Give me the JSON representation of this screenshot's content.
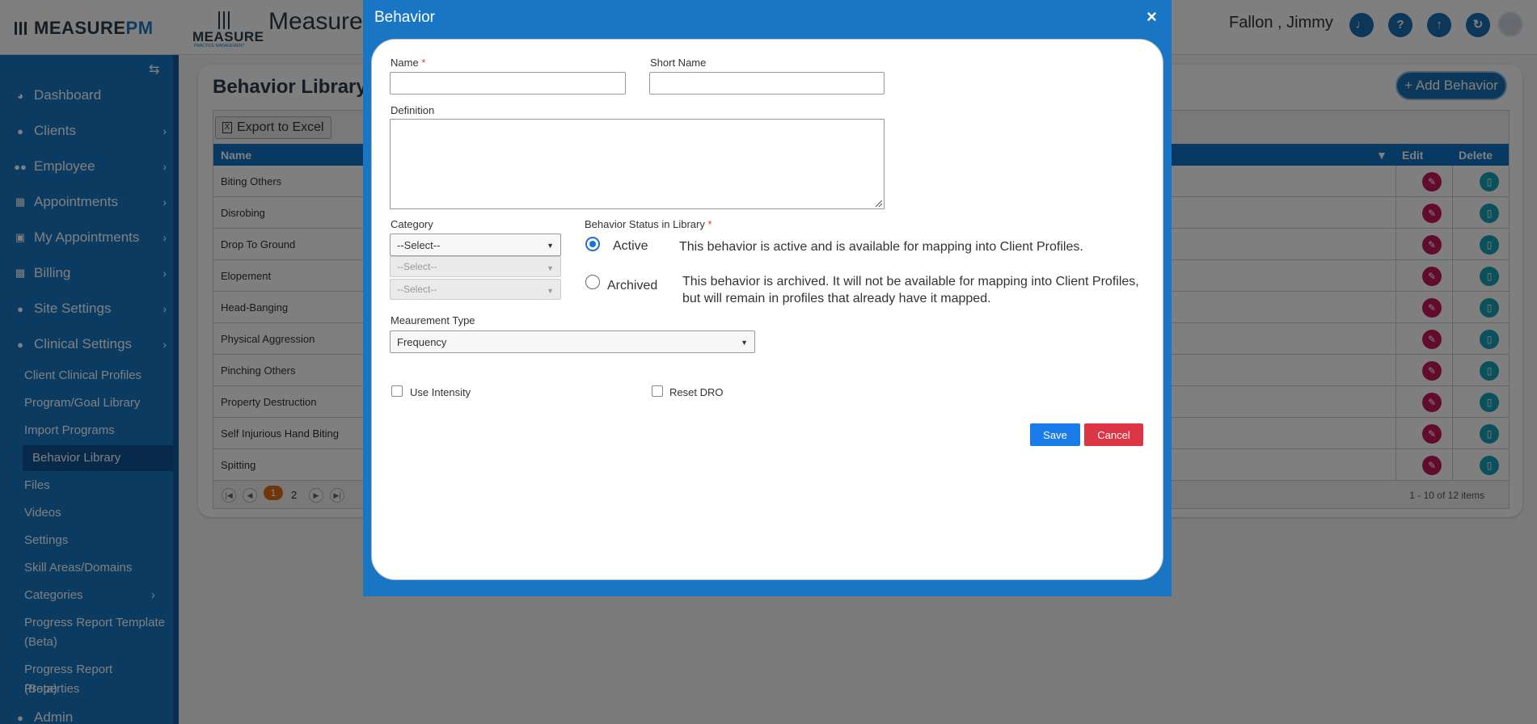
{
  "header": {
    "brand_main": "MEASURE",
    "brand_accent": "PM",
    "practice_logo_word": "MEASURE",
    "practice_logo_sub": "PRACTICE MANAGEMENT",
    "app_title": "MeasureP",
    "user_name": "Fallon , Jimmy",
    "icons": [
      "bell-icon",
      "help-icon",
      "upload-icon",
      "refresh-icon",
      "avatar"
    ]
  },
  "sidebar": {
    "items": [
      {
        "label": "Dashboard",
        "icon": "dashboard-icon"
      },
      {
        "label": "Clients",
        "icon": "user-icon"
      },
      {
        "label": "Employee",
        "icon": "users-icon"
      },
      {
        "label": "Appointments",
        "icon": "calendar-icon"
      },
      {
        "label": "My Appointments",
        "icon": "book-icon"
      },
      {
        "label": "Billing",
        "icon": "money-icon"
      },
      {
        "label": "Site Settings",
        "icon": "user-icon"
      },
      {
        "label": "Clinical Settings",
        "icon": "user-icon"
      }
    ],
    "sub_items": [
      {
        "label": "Client Clinical Profiles"
      },
      {
        "label": "Program/Goal Library"
      },
      {
        "label": "Import Programs"
      },
      {
        "label": "Behavior Library"
      },
      {
        "label": "Files"
      },
      {
        "label": "Videos"
      },
      {
        "label": "Settings"
      },
      {
        "label": "Skill Areas/Domains"
      },
      {
        "label": "Categories"
      },
      {
        "label": "Progress Report Template"
      },
      {
        "label": "(Beta)"
      },
      {
        "label": "Progress Report Properties"
      },
      {
        "label": "(Beta)"
      },
      {
        "label": "Admin"
      }
    ]
  },
  "main": {
    "title": "Behavior Library",
    "add_button": "+ Add Behavior",
    "export_button": "Export to Excel",
    "columns": {
      "name": "Name",
      "edit": "Edit",
      "delete": "Delete"
    },
    "rows": [
      "Biting Others",
      "Disrobing",
      "Drop To Ground",
      "Elopement",
      "Head-Banging",
      "Physical Aggression",
      "Pinching Others",
      "Property Destruction",
      "Self Injurious Hand Biting",
      "Spitting"
    ],
    "pager": {
      "current": "1",
      "next": "2",
      "count": "1 - 10 of 12 items"
    }
  },
  "modal": {
    "title": "Behavior",
    "close": "×",
    "name_label": "Name",
    "required_mark": "*",
    "short_name_label": "Short Name",
    "definition_label": "Definition",
    "category_label": "Category",
    "category_value": "--Select--",
    "subcategory1_value": "--Select--",
    "subcategory2_value": "--Select--",
    "status_label": "Behavior Status in Library",
    "active_label": "Active",
    "active_desc": "This behavior is active and is available for mapping into Client Profiles.",
    "archived_label": "Archived",
    "archived_desc_1": "This behavior is archived. It will not be available for mapping into Client Profiles,",
    "archived_desc_2": "but will remain in profiles that already have it mapped.",
    "measurement_label": "Meaurement Type",
    "measurement_value": "Frequency",
    "use_intensity_label": "Use Intensity",
    "reset_dro_label": "Reset DRO",
    "save": "Save",
    "cancel": "Cancel"
  }
}
